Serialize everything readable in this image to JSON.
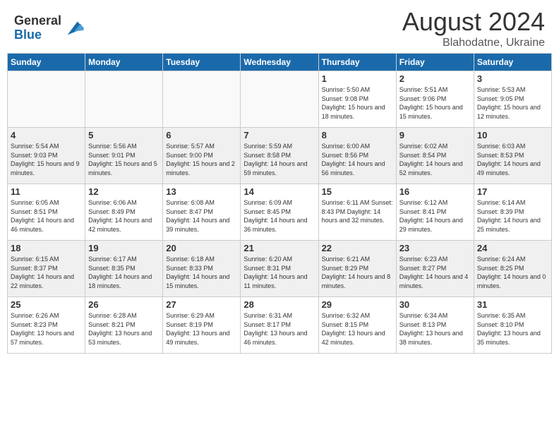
{
  "header": {
    "logo_general": "General",
    "logo_blue": "Blue",
    "main_title": "August 2024",
    "sub_title": "Blahodatne, Ukraine"
  },
  "days_of_week": [
    "Sunday",
    "Monday",
    "Tuesday",
    "Wednesday",
    "Thursday",
    "Friday",
    "Saturday"
  ],
  "weeks": [
    [
      {
        "day": "",
        "empty": true
      },
      {
        "day": "",
        "empty": true
      },
      {
        "day": "",
        "empty": true
      },
      {
        "day": "",
        "empty": true
      },
      {
        "day": "1",
        "info": "Sunrise: 5:50 AM\nSunset: 9:08 PM\nDaylight: 15 hours\nand 18 minutes."
      },
      {
        "day": "2",
        "info": "Sunrise: 5:51 AM\nSunset: 9:06 PM\nDaylight: 15 hours\nand 15 minutes."
      },
      {
        "day": "3",
        "info": "Sunrise: 5:53 AM\nSunset: 9:05 PM\nDaylight: 15 hours\nand 12 minutes."
      }
    ],
    [
      {
        "day": "4",
        "info": "Sunrise: 5:54 AM\nSunset: 9:03 PM\nDaylight: 15 hours\nand 9 minutes."
      },
      {
        "day": "5",
        "info": "Sunrise: 5:56 AM\nSunset: 9:01 PM\nDaylight: 15 hours\nand 5 minutes."
      },
      {
        "day": "6",
        "info": "Sunrise: 5:57 AM\nSunset: 9:00 PM\nDaylight: 15 hours\nand 2 minutes."
      },
      {
        "day": "7",
        "info": "Sunrise: 5:59 AM\nSunset: 8:58 PM\nDaylight: 14 hours\nand 59 minutes."
      },
      {
        "day": "8",
        "info": "Sunrise: 6:00 AM\nSunset: 8:56 PM\nDaylight: 14 hours\nand 56 minutes."
      },
      {
        "day": "9",
        "info": "Sunrise: 6:02 AM\nSunset: 8:54 PM\nDaylight: 14 hours\nand 52 minutes."
      },
      {
        "day": "10",
        "info": "Sunrise: 6:03 AM\nSunset: 8:53 PM\nDaylight: 14 hours\nand 49 minutes."
      }
    ],
    [
      {
        "day": "11",
        "info": "Sunrise: 6:05 AM\nSunset: 8:51 PM\nDaylight: 14 hours\nand 46 minutes."
      },
      {
        "day": "12",
        "info": "Sunrise: 6:06 AM\nSunset: 8:49 PM\nDaylight: 14 hours\nand 42 minutes."
      },
      {
        "day": "13",
        "info": "Sunrise: 6:08 AM\nSunset: 8:47 PM\nDaylight: 14 hours\nand 39 minutes."
      },
      {
        "day": "14",
        "info": "Sunrise: 6:09 AM\nSunset: 8:45 PM\nDaylight: 14 hours\nand 36 minutes."
      },
      {
        "day": "15",
        "info": "Sunrise: 6:11 AM\nSunset: 8:43 PM\nDaylight: 14 hours\nand 32 minutes."
      },
      {
        "day": "16",
        "info": "Sunrise: 6:12 AM\nSunset: 8:41 PM\nDaylight: 14 hours\nand 29 minutes."
      },
      {
        "day": "17",
        "info": "Sunrise: 6:14 AM\nSunset: 8:39 PM\nDaylight: 14 hours\nand 25 minutes."
      }
    ],
    [
      {
        "day": "18",
        "info": "Sunrise: 6:15 AM\nSunset: 8:37 PM\nDaylight: 14 hours\nand 22 minutes."
      },
      {
        "day": "19",
        "info": "Sunrise: 6:17 AM\nSunset: 8:35 PM\nDaylight: 14 hours\nand 18 minutes."
      },
      {
        "day": "20",
        "info": "Sunrise: 6:18 AM\nSunset: 8:33 PM\nDaylight: 14 hours\nand 15 minutes."
      },
      {
        "day": "21",
        "info": "Sunrise: 6:20 AM\nSunset: 8:31 PM\nDaylight: 14 hours\nand 11 minutes."
      },
      {
        "day": "22",
        "info": "Sunrise: 6:21 AM\nSunset: 8:29 PM\nDaylight: 14 hours\nand 8 minutes."
      },
      {
        "day": "23",
        "info": "Sunrise: 6:23 AM\nSunset: 8:27 PM\nDaylight: 14 hours\nand 4 minutes."
      },
      {
        "day": "24",
        "info": "Sunrise: 6:24 AM\nSunset: 8:25 PM\nDaylight: 14 hours\nand 0 minutes."
      }
    ],
    [
      {
        "day": "25",
        "info": "Sunrise: 6:26 AM\nSunset: 8:23 PM\nDaylight: 13 hours\nand 57 minutes."
      },
      {
        "day": "26",
        "info": "Sunrise: 6:28 AM\nSunset: 8:21 PM\nDaylight: 13 hours\nand 53 minutes."
      },
      {
        "day": "27",
        "info": "Sunrise: 6:29 AM\nSunset: 8:19 PM\nDaylight: 13 hours\nand 49 minutes."
      },
      {
        "day": "28",
        "info": "Sunrise: 6:31 AM\nSunset: 8:17 PM\nDaylight: 13 hours\nand 46 minutes."
      },
      {
        "day": "29",
        "info": "Sunrise: 6:32 AM\nSunset: 8:15 PM\nDaylight: 13 hours\nand 42 minutes."
      },
      {
        "day": "30",
        "info": "Sunrise: 6:34 AM\nSunset: 8:13 PM\nDaylight: 13 hours\nand 38 minutes."
      },
      {
        "day": "31",
        "info": "Sunrise: 6:35 AM\nSunset: 8:10 PM\nDaylight: 13 hours\nand 35 minutes."
      }
    ]
  ]
}
